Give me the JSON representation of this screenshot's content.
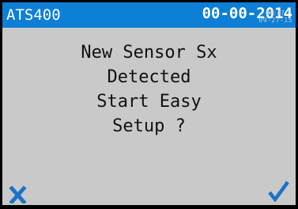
{
  "header": {
    "title": "ATS400",
    "date": "00-00-2014",
    "overlay_time": "10:47",
    "overlay_date": "09-27-15"
  },
  "message": {
    "lines": [
      "New Sensor Sx",
      "Detected",
      "Start Easy",
      "Setup ?"
    ]
  },
  "footer": {
    "cancel_icon": "close-icon",
    "confirm_icon": "checkmark-icon"
  },
  "colors": {
    "header_bg": "#0e7fd6",
    "screen_bg": "#c9c9c9",
    "icon": "#1a73c9"
  }
}
